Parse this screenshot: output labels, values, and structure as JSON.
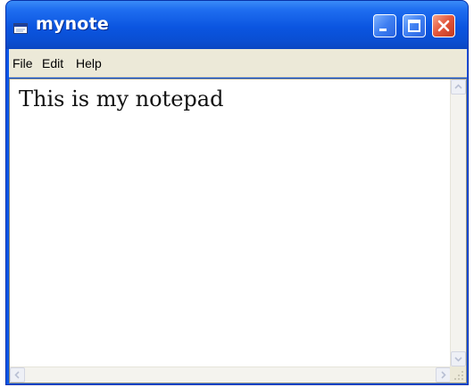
{
  "window": {
    "title": "mynote",
    "icons": {
      "app": "notepad-icon",
      "minimize": "minimize-icon",
      "maximize": "maximize-icon",
      "close": "close-icon"
    },
    "colors": {
      "titlebar": "#0b55e0",
      "close_button": "#e2553a",
      "menubar": "#ece9d8"
    }
  },
  "menu": {
    "file": "File",
    "edit": "Edit",
    "help": "Help"
  },
  "editor": {
    "content": "This is my notepad"
  },
  "scrollbars": {
    "up_icon": "chevron-up-icon",
    "down_icon": "chevron-down-icon",
    "left_icon": "chevron-left-icon",
    "right_icon": "chevron-right-icon",
    "grip_icon": "resize-grip-icon"
  }
}
